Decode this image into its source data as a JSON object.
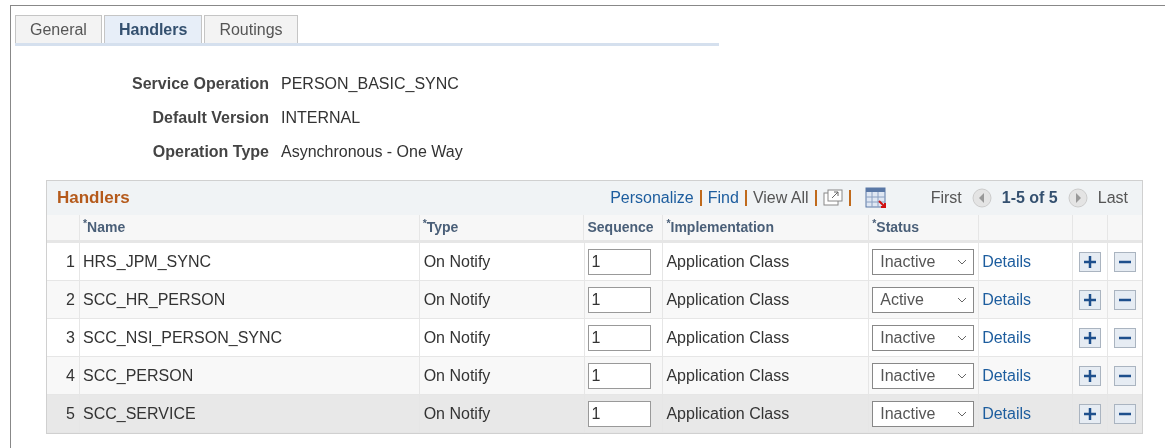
{
  "tabs": [
    {
      "label": "General",
      "selected": false
    },
    {
      "label": "Handlers",
      "selected": true
    },
    {
      "label": "Routings",
      "selected": false
    }
  ],
  "fields": [
    {
      "label": "Service Operation",
      "value": "PERSON_BASIC_SYNC"
    },
    {
      "label": "Default Version",
      "value": "INTERNAL"
    },
    {
      "label": "Operation Type",
      "value": "Asynchronous - One Way"
    }
  ],
  "grid": {
    "title": "Handlers",
    "links": [
      "Personalize",
      "Find",
      "View All"
    ],
    "nav": {
      "first": "First",
      "range": "1-5 of 5",
      "last": "Last"
    },
    "columns": [
      "$^{*}$Name",
      "$^{*}$Type",
      "Sequence",
      "$^{*}$Implementation",
      "$^{*}$Status"
    ],
    "rows": [
      {
        "number": "1",
        "name": "HRS_JPM_SYNC",
        "type": "On Notify",
        "sequence": "1",
        "implementation": "Application Class",
        "status": "Inactive",
        "link": "Details",
        "selected": false
      },
      {
        "number": "2",
        "name": "SCC_HR_PERSON",
        "type": "On Notify",
        "sequence": "1",
        "implementation": "Application Class",
        "status": "Active",
        "link": "Details",
        "selected": false
      },
      {
        "number": "3",
        "name": "SCC_NSI_PERSON_SYNC",
        "type": "On Notify",
        "sequence": "1",
        "implementation": "Application Class",
        "status": "Inactive",
        "link": "Details",
        "selected": false
      },
      {
        "number": "4",
        "name": "SCC_PERSON",
        "type": "On Notify",
        "sequence": "1",
        "implementation": "Application Class",
        "status": "Inactive",
        "link": "Details",
        "selected": false
      },
      {
        "number": "5",
        "name": "SCC_SERVICE",
        "type": "On Notify",
        "sequence": "1",
        "implementation": "Application Class",
        "status": "Inactive",
        "link": "Details",
        "selected": true
      }
    ]
  }
}
